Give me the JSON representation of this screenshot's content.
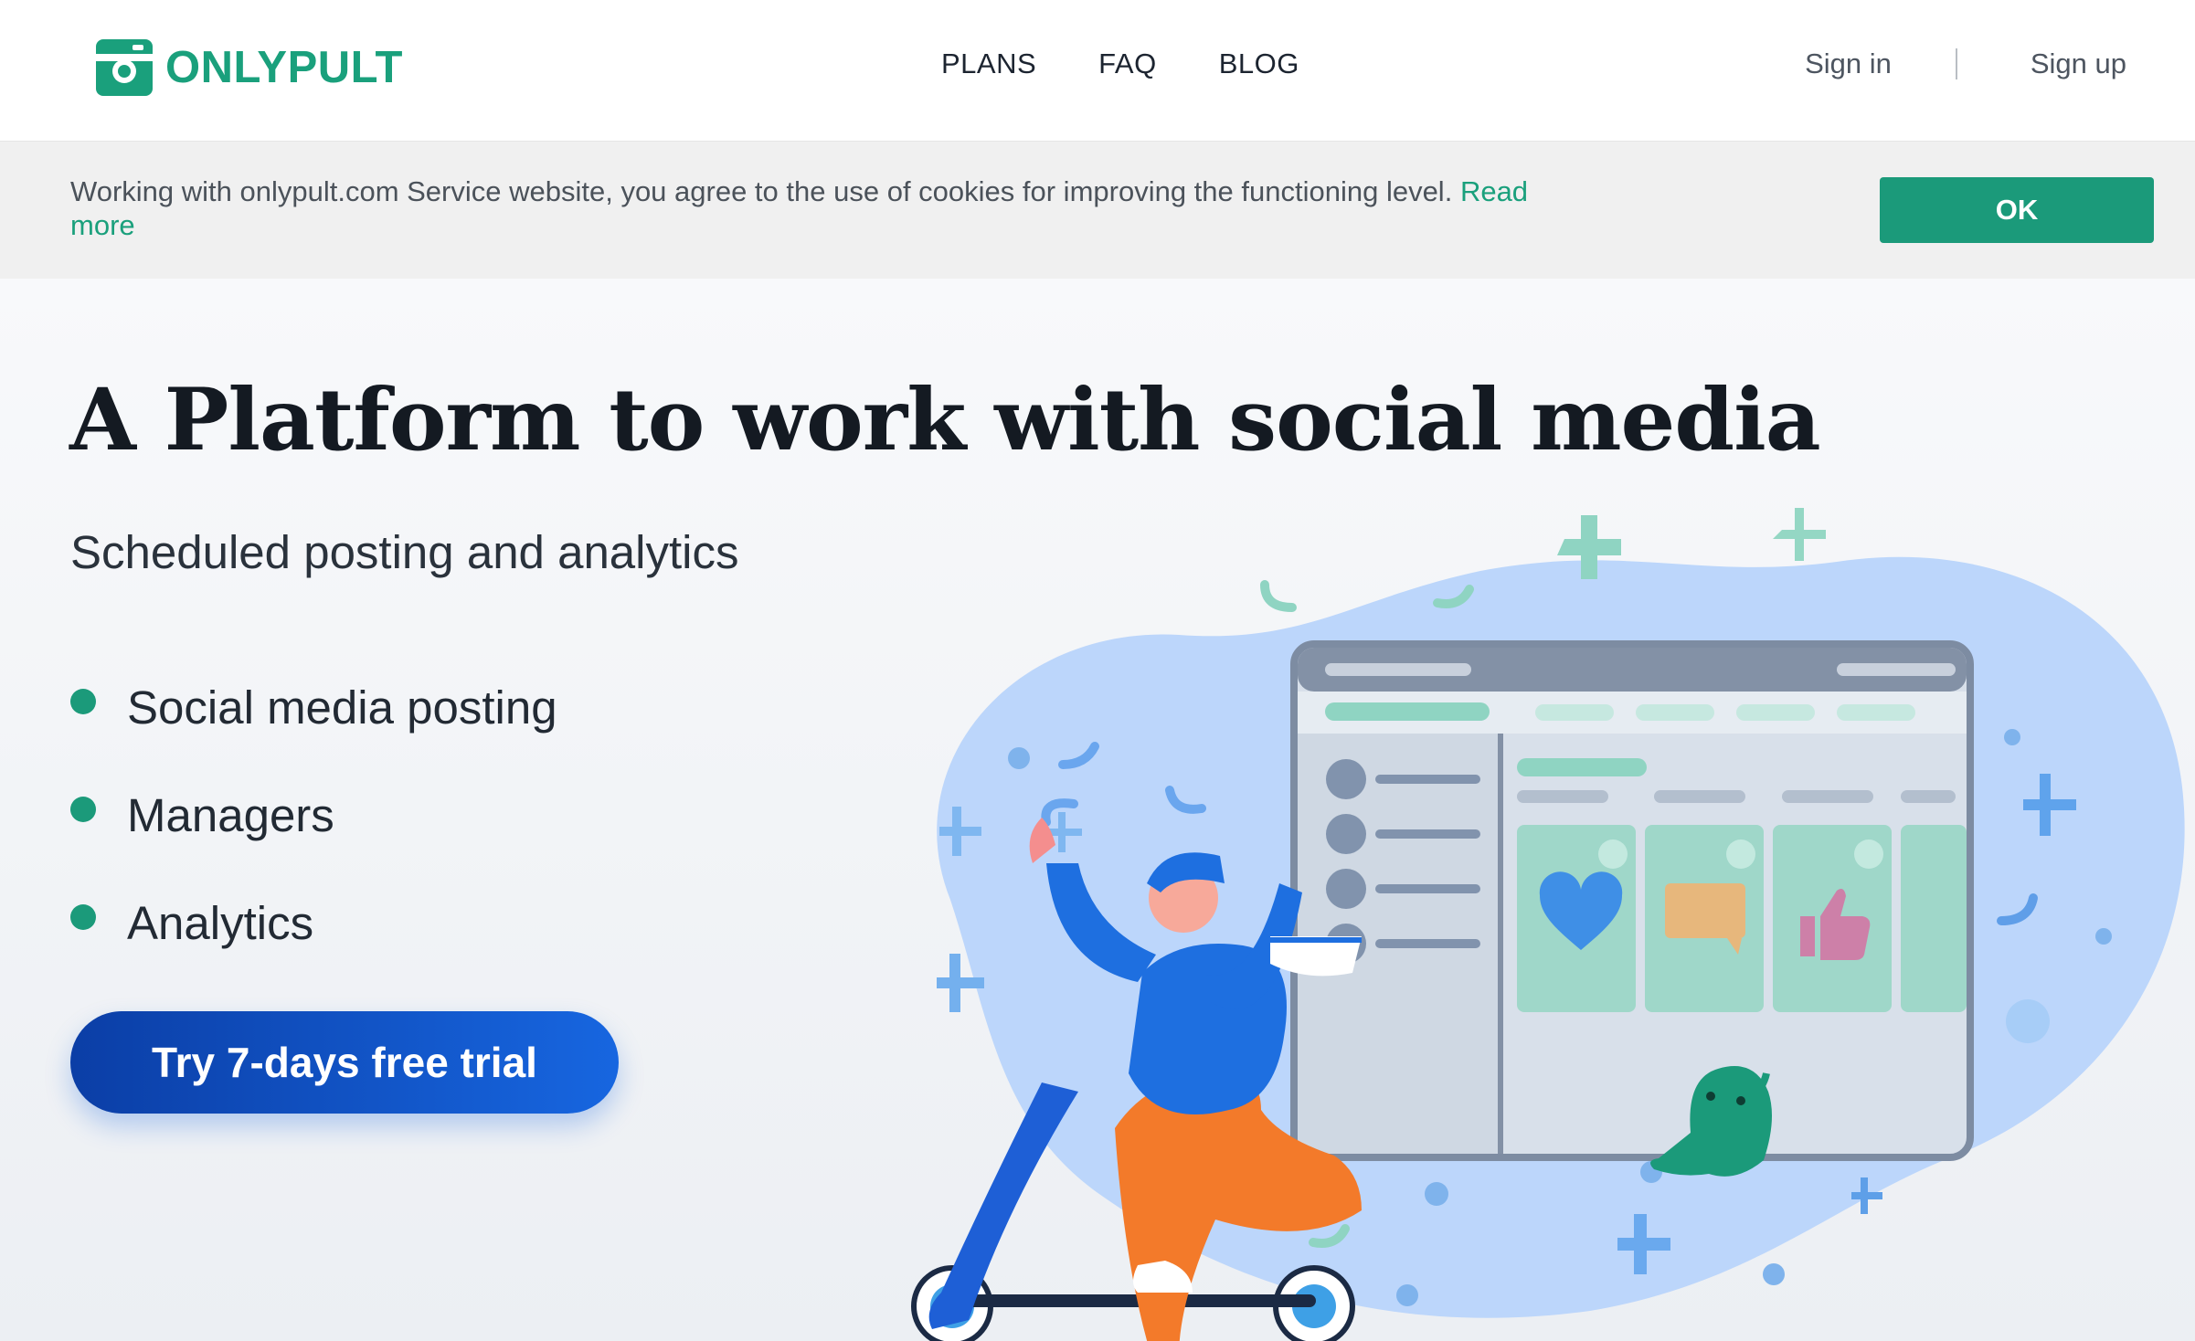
{
  "brand": {
    "name": "ONLYPULT",
    "color": "#1aa07c"
  },
  "nav": {
    "items": [
      "PLANS",
      "FAQ",
      "BLOG"
    ]
  },
  "auth": {
    "sign_in": "Sign in",
    "sign_up": "Sign up"
  },
  "cookie": {
    "text": "Working with onlypult.com Service website, you agree to the use of cookies for improving the functioning level. ",
    "link": "Read more",
    "ok_label": "OK"
  },
  "hero": {
    "title": "A Platform to work with social media",
    "subtitle": "Scheduled posting and analytics",
    "features": [
      "Social media posting",
      "Managers",
      "Analytics"
    ],
    "cta_label": "Try 7-days free trial"
  },
  "illustration": {
    "icons": [
      "person-on-scooter",
      "dashboard-window",
      "heart-icon",
      "chat-icon",
      "thumbs-up-icon",
      "green-creature"
    ]
  },
  "colors": {
    "accent": "#1b9a7a",
    "cta_start": "#0b3ea6",
    "cta_end": "#1766e0",
    "blob": "#bcd6fb"
  }
}
